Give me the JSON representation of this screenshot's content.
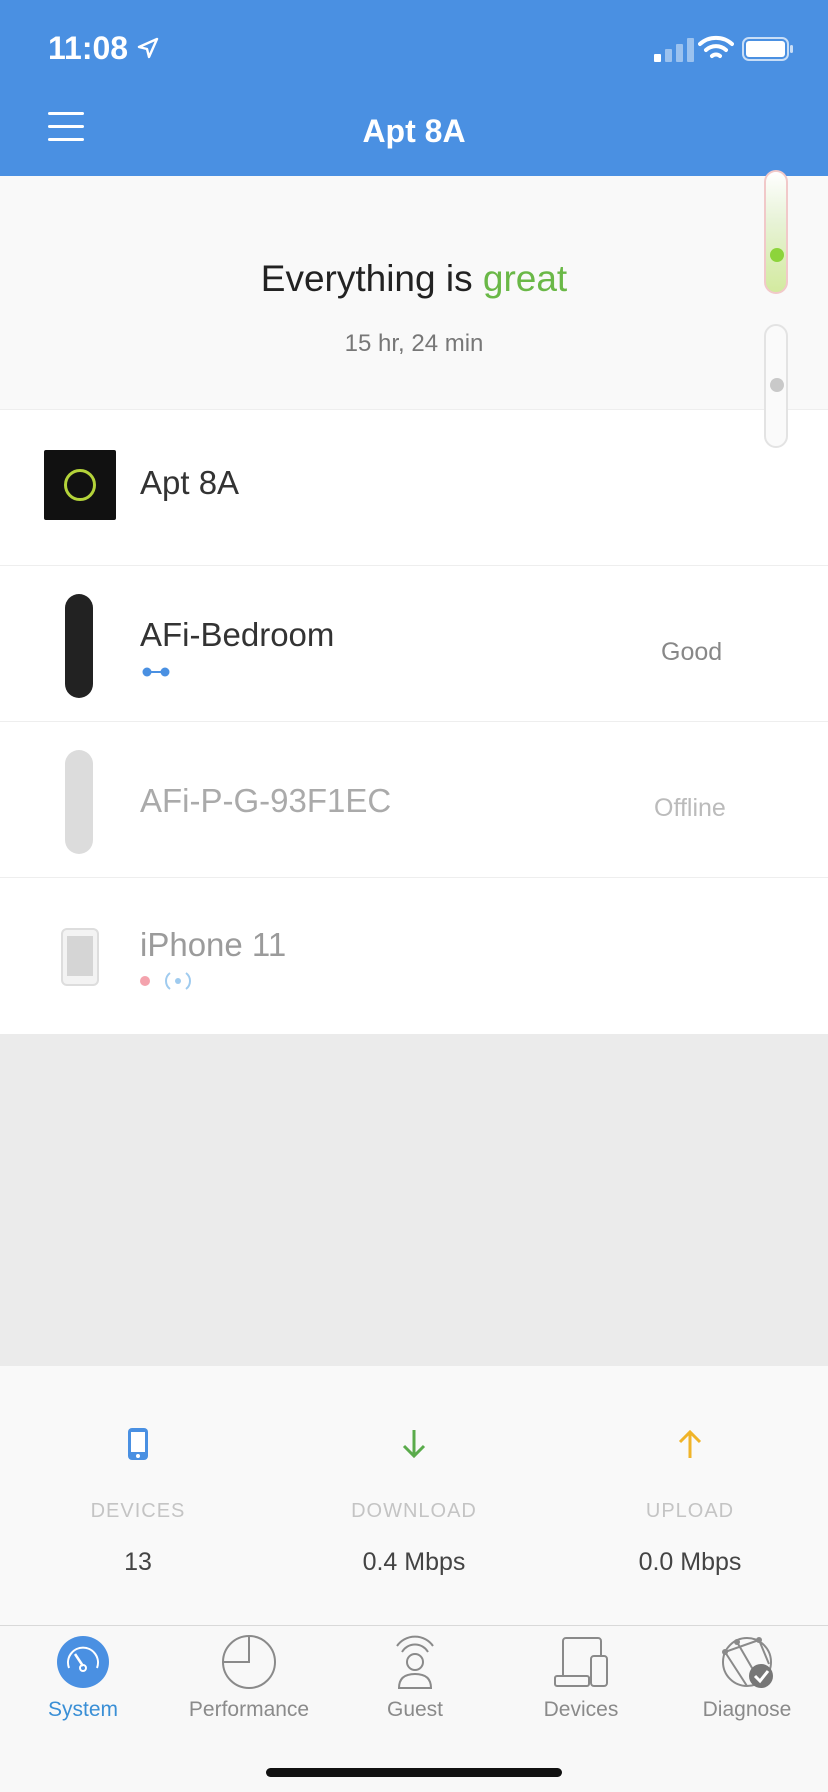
{
  "status_bar": {
    "time": "11:08"
  },
  "header": {
    "title": "Apt 8A"
  },
  "summary": {
    "headline_prefix": "Everything is ",
    "headline_status": "great",
    "uptime": "15 hr, 24 min"
  },
  "devices_list": [
    {
      "name": "Apt 8A",
      "type": "router"
    },
    {
      "name": "AFi-Bedroom",
      "type": "satellite",
      "status": "Good"
    },
    {
      "name": "AFi-P-G-93F1EC",
      "type": "satellite",
      "status": "Offline"
    },
    {
      "name": "iPhone 11",
      "type": "phone"
    }
  ],
  "stats": {
    "devices": {
      "label": "DEVICES",
      "value": "13"
    },
    "download": {
      "label": "DOWNLOAD",
      "value": "0.4 Mbps"
    },
    "upload": {
      "label": "UPLOAD",
      "value": "0.0 Mbps"
    }
  },
  "tabs": [
    {
      "label": "System",
      "active": true
    },
    {
      "label": "Performance",
      "active": false
    },
    {
      "label": "Guest",
      "active": false
    },
    {
      "label": "Devices",
      "active": false
    },
    {
      "label": "Diagnose",
      "active": false
    }
  ],
  "colors": {
    "header_bg": "#4a90e2",
    "great": "#6ab847",
    "download_arrow": "#5aab4b",
    "upload_arrow": "#f0b429",
    "active_tab": "#3a8fd6"
  }
}
